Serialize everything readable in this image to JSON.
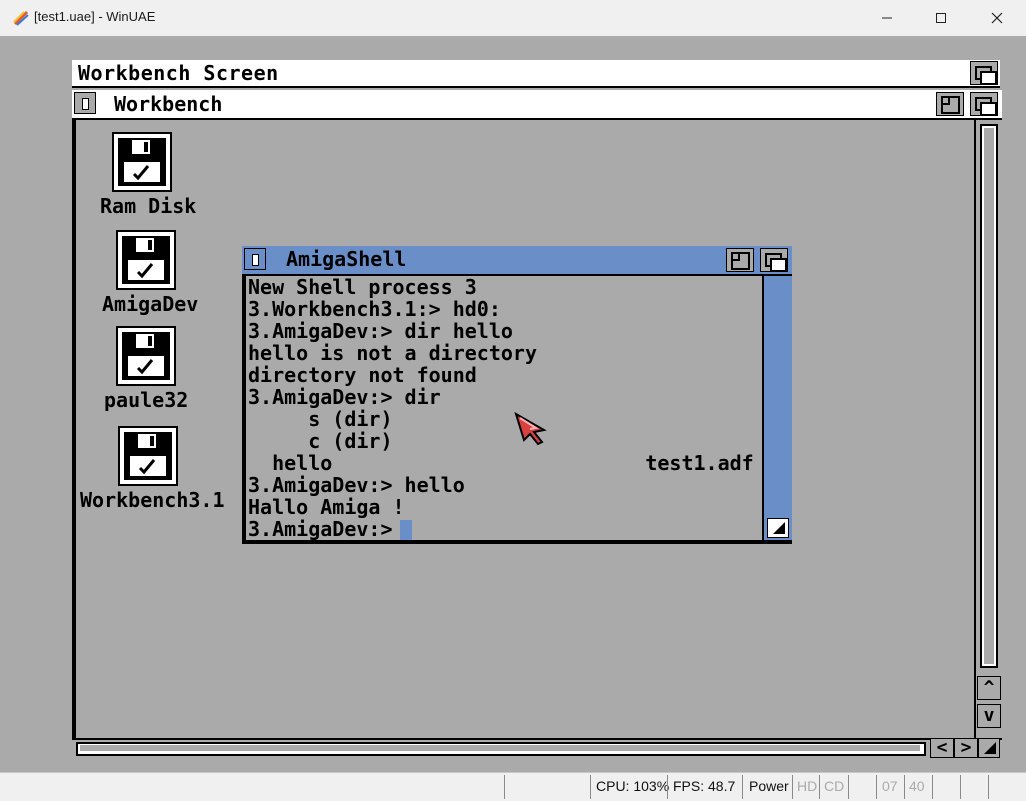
{
  "window": {
    "title": "[test1.uae] - WinUAE"
  },
  "screen": {
    "title": "Workbench Screen"
  },
  "workbench": {
    "title": "Workbench"
  },
  "icons": [
    {
      "label": "Ram Disk"
    },
    {
      "label": "AmigaDev"
    },
    {
      "label": "paule32"
    },
    {
      "label": "Workbench3.1"
    }
  ],
  "shell": {
    "title": "AmigaShell",
    "lines": [
      "New Shell process 3",
      "3.Workbench3.1:> hd0:",
      "3.AmigaDev:> dir hello",
      "hello is not a directory",
      "directory not found",
      "3.AmigaDev:> dir",
      "     s (dir)",
      "     c (dir)",
      "  hello                          test1.adf",
      "3.AmigaDev:> hello",
      "Hallo Amiga !",
      "3.AmigaDev:> "
    ]
  },
  "status": {
    "cpu": "CPU: 103%",
    "fps": "FPS: 48.7",
    "power": "Power",
    "hd": "HD",
    "cd": "CD",
    "df1": "07",
    "df2": "40"
  },
  "colors": {
    "shell_accent": "#6a8fc8",
    "workbench_gray": "#aaaaaa"
  }
}
